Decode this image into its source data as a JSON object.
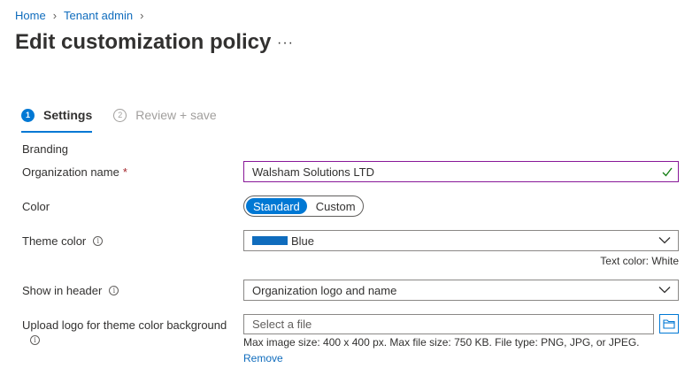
{
  "breadcrumb": {
    "items": [
      "Home",
      "Tenant admin"
    ]
  },
  "page": {
    "title": "Edit customization policy",
    "more_label": "···"
  },
  "tabs": [
    {
      "number": "1",
      "label": "Settings"
    },
    {
      "number": "2",
      "label": "Review + save"
    }
  ],
  "form": {
    "section": "Branding",
    "org_name": {
      "label": "Organization name",
      "required_mark": "*",
      "value": "Walsham Solutions LTD"
    },
    "color": {
      "label": "Color",
      "options": [
        "Standard",
        "Custom"
      ],
      "selected": "Standard"
    },
    "theme_color": {
      "label": "Theme color",
      "value": "Blue",
      "swatch_color": "#0f6cbd",
      "text_color_note": "Text color: White"
    },
    "show_in_header": {
      "label": "Show in header",
      "value": "Organization logo and name"
    },
    "upload_logo": {
      "label": "Upload logo for theme color background",
      "placeholder": "Select a file",
      "hint": "Max image size: 400 x 400 px. Max file size: 750 KB. File type: PNG, JPG, or JPEG.",
      "remove_label": "Remove"
    },
    "info_glyph": "i"
  },
  "colors": {
    "accent": "#0078d4",
    "link": "#0f6cbd",
    "valid_border": "#881798",
    "valid_check": "#107c10"
  }
}
